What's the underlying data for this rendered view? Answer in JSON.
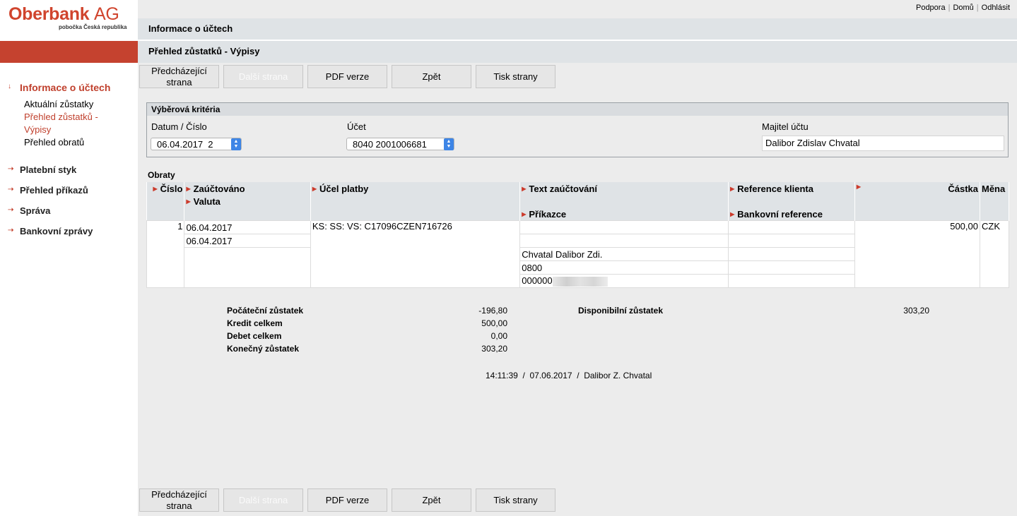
{
  "brand": {
    "logo_main": "Oberbank",
    "logo_suffix": "AG",
    "logo_sub": "pobočka Česká republika",
    "accent": "#c5422f"
  },
  "toplinks": [
    "Podpora",
    "Domů",
    "Odhlásit"
  ],
  "nav": {
    "section_active": "Informace o účtech",
    "subitems": [
      "Aktuální zůstatky",
      "Přehled zůstatků - Výpisy",
      "Přehled obratů"
    ],
    "items": [
      "Platební styk",
      "Přehled příkazů",
      "Správa",
      "Bankovní zprávy"
    ]
  },
  "header": {
    "title1": "Informace o účtech",
    "title2": "Přehled zůstatků - Výpisy"
  },
  "toolbar": {
    "prev": "Předcházející strana",
    "next": "Další strana",
    "pdf": "PDF verze",
    "back": "Zpět",
    "print": "Tisk strany"
  },
  "criteria": {
    "title": "Výběrová kritéria",
    "date_label": "Datum / Číslo",
    "date_value": "06.04.2017  2",
    "account_label": "Účet",
    "account_value": "8040 2001006681",
    "owner_label": "Majitel účtu",
    "owner_value": "Dalibor Zdislav Chvatal"
  },
  "obraty": {
    "title": "Obraty",
    "headers": {
      "cislo": "Číslo",
      "zauctovano": "Zaúčtováno",
      "valuta": "Valuta",
      "ucel": "Účel platby",
      "text": "Text zaúčtování",
      "prikazce": "Příkazce",
      "ref_klienta": "Reference klienta",
      "bank_ref": "Bankovní reference",
      "castka": "Částka",
      "mena": "Měna"
    },
    "row": {
      "cislo": "1",
      "zauctovano": "06.04.2017",
      "valuta": "06.04.2017",
      "ucel": "KS: SS: VS: C17096CZEN716726",
      "castka": "500,00",
      "mena": "CZK",
      "prikazce_name": "Chvatal Dalibor Zdi.",
      "prikazce_bank": "0800",
      "prikazce_acct": "000000"
    }
  },
  "summary": {
    "pocatecni_label": "Počáteční zůstatek",
    "pocatecni_value": "-196,80",
    "kredit_label": "Kredit celkem",
    "kredit_value": "500,00",
    "debet_label": "Debet celkem",
    "debet_value": "0,00",
    "konecny_label": "Konečný zůstatek",
    "konecny_value": "303,20",
    "disponibilni_label": "Disponibilní zůstatek",
    "disponibilni_value": "303,20"
  },
  "footer": {
    "line": "14:11:39  /  07.06.2017  /  Dalibor Z. Chvatal"
  }
}
